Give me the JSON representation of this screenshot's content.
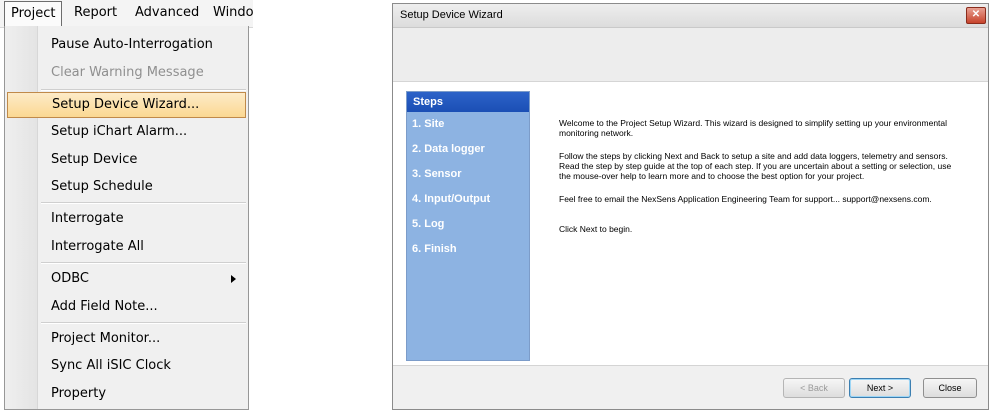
{
  "menubar": {
    "items": [
      "Project",
      "Report",
      "Advanced",
      "Windo"
    ]
  },
  "menu": {
    "items": [
      "Pause Auto-Interrogation",
      "Clear Warning Message",
      "Setup Device Wizard...",
      "Setup iChart Alarm...",
      "Setup Device",
      "Setup Schedule",
      "Interrogate",
      "Interrogate All",
      "ODBC",
      "Add Field Note...",
      "Project Monitor...",
      "Sync All iSIC Clock",
      "Property"
    ],
    "disabled_item": "Clear Warning Message",
    "highlighted_item": "Setup Device Wizard...",
    "submenu_item": "ODBC"
  },
  "wizard": {
    "title": "Setup Device Wizard",
    "steps_header": "Steps",
    "steps": [
      "1. Site",
      "2. Data logger",
      "3. Sensor",
      "4. Input/Output",
      "5. Log",
      "6. Finish"
    ],
    "paragraphs": [
      "Welcome to the Project Setup Wizard. This wizard is designed to simplify setting up your environmental monitoring network.",
      "Follow the steps by clicking Next and Back to setup a site and add data loggers, telemetry and sensors. Read the step by step guide at the top of each step. If you are uncertain about a setting or selection, use the mouse-over help to learn more and to choose the best option for your project.",
      "Feel free to email the NexSens Application Engineering Team for support... support@nexsens.com.",
      "Click Next to begin."
    ],
    "buttons": {
      "back": "< Back",
      "next": "Next >",
      "close": "Close"
    }
  },
  "colors": {
    "menu_highlight": "#fbd892",
    "steps_panel": "#8db3e2",
    "steps_header": "#1b4fb5"
  }
}
